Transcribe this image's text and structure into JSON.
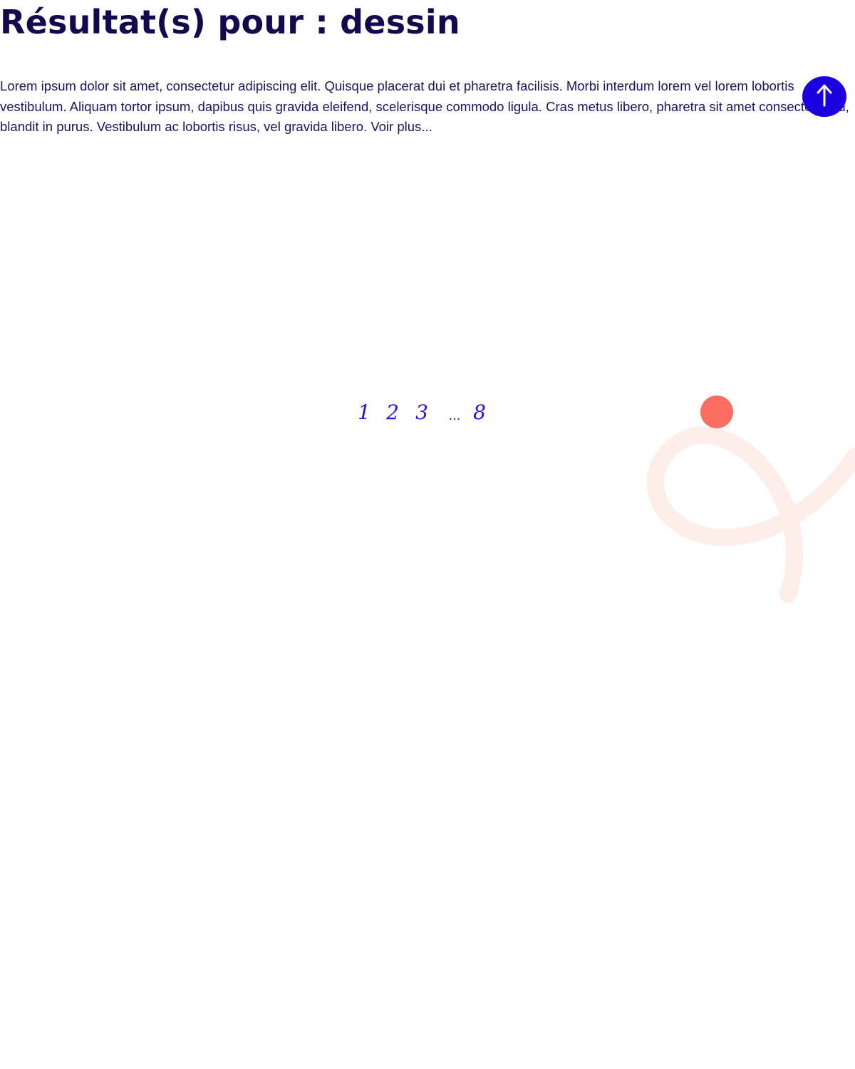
{
  "search": {
    "title": "Résultat(s) pour : dessin",
    "intro_text": "Lorem ipsum dolor sit amet, consectetur adipiscing elit. Quisque placerat dui et pharetra facilisis. Morbi interdum lorem vel lorem lobortis vestibulum. Aliquam tortor ipsum, dapibus quis gravida eleifend, scelerisque commodo ligula. Cras metus libero, pharetra sit amet consectetur eu, blandit in purus. Vestibulum ac lobortis risus, vel gravida libero.",
    "read_more_label": "Voir plus..."
  },
  "pagination": {
    "pages": [
      "1",
      "2",
      "3",
      "...",
      "8"
    ]
  },
  "back_to_top": {
    "icon": "arrow-up-icon"
  },
  "colors": {
    "heading": "#120a4e",
    "accent": "#1a00e0",
    "coral": "#fb6f63",
    "decor_light": "#fdeeea"
  }
}
